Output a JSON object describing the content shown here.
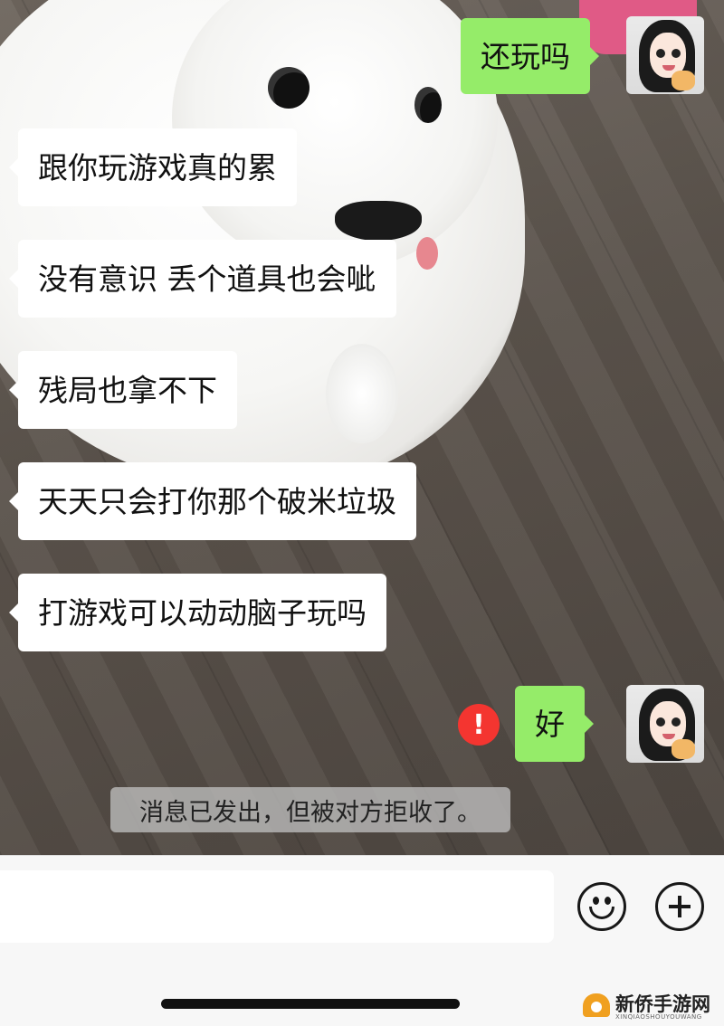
{
  "conversation": {
    "messages": [
      {
        "side": "right",
        "text": "还玩吗"
      },
      {
        "side": "left",
        "text": "跟你玩游戏真的累"
      },
      {
        "side": "left",
        "text": "没有意识 丢个道具也会呲"
      },
      {
        "side": "left",
        "text": "残局也拿不下"
      },
      {
        "side": "left",
        "text": "天天只会打你那个破米垃圾"
      },
      {
        "side": "left",
        "text": "打游戏可以动动脑子玩吗"
      },
      {
        "side": "right",
        "text": "好"
      }
    ],
    "failed_send_icon": "!",
    "system_notice": "消息已发出，但被对方拒收了。"
  },
  "input_bar": {
    "input_value": "",
    "emoji_button_icon": "smiley-icon",
    "more_button_icon": "plus-icon"
  },
  "watermark": {
    "brand": "新侨手游网",
    "sub": "XINQIAOSHOUYOUWANG"
  },
  "colors": {
    "sent_bubble": "#95ec69",
    "received_bubble": "#ffffff",
    "alert_red": "#f43530"
  }
}
